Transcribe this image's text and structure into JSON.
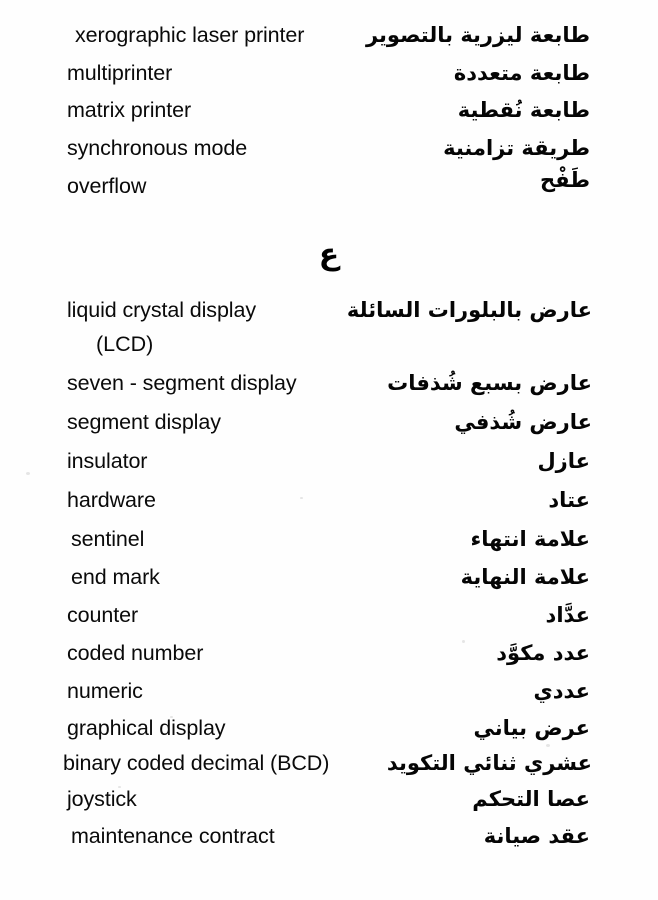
{
  "page": {
    "type": "dictionary-page",
    "direction_note": "english-left-arabic-right",
    "background_color": "#fefefe",
    "text_color": "#000000"
  },
  "section_header": {
    "letter": "ع"
  },
  "block_one": {
    "entries": [
      {
        "english": "xerographic laser printer",
        "arabic": "طابعة ليزرية بالتصوير"
      },
      {
        "english": "multiprinter",
        "arabic": "طابعة متعددة"
      },
      {
        "english": "matrix printer",
        "arabic": "طابعة نُقطية"
      },
      {
        "english": "synchronous mode",
        "arabic": "طريقة تزامنية"
      },
      {
        "english": "overflow",
        "arabic": "طَفْح"
      }
    ]
  },
  "block_two": {
    "entries": [
      {
        "english": "liquid crystal display",
        "continuation": "(LCD)",
        "arabic": "عارض بالبلورات السائلة"
      },
      {
        "english": "seven - segment display",
        "arabic": "عارض بسبع شُذفات"
      },
      {
        "english": "segment display",
        "arabic": "عارض شُذفي"
      },
      {
        "english": "insulator",
        "arabic": "عازل"
      },
      {
        "english": "hardware",
        "arabic": "عتاد"
      },
      {
        "english": "sentinel",
        "arabic": "علامة انتهاء"
      },
      {
        "english": "end mark",
        "arabic": "علامة النهاية"
      },
      {
        "english": "counter",
        "arabic": "عدَّاد"
      },
      {
        "english": "coded number",
        "arabic": "عدد مكوَّد"
      },
      {
        "english": "numeric",
        "arabic": "عددي"
      },
      {
        "english": "graphical display",
        "arabic": "عرض بياني"
      },
      {
        "english": "binary coded decimal (BCD)",
        "arabic": "عشري ثنائي التكويد"
      },
      {
        "english": "joystick",
        "arabic": "عصا التحكم"
      },
      {
        "english": "maintenance contract",
        "arabic": "عقد صيانة"
      }
    ]
  }
}
